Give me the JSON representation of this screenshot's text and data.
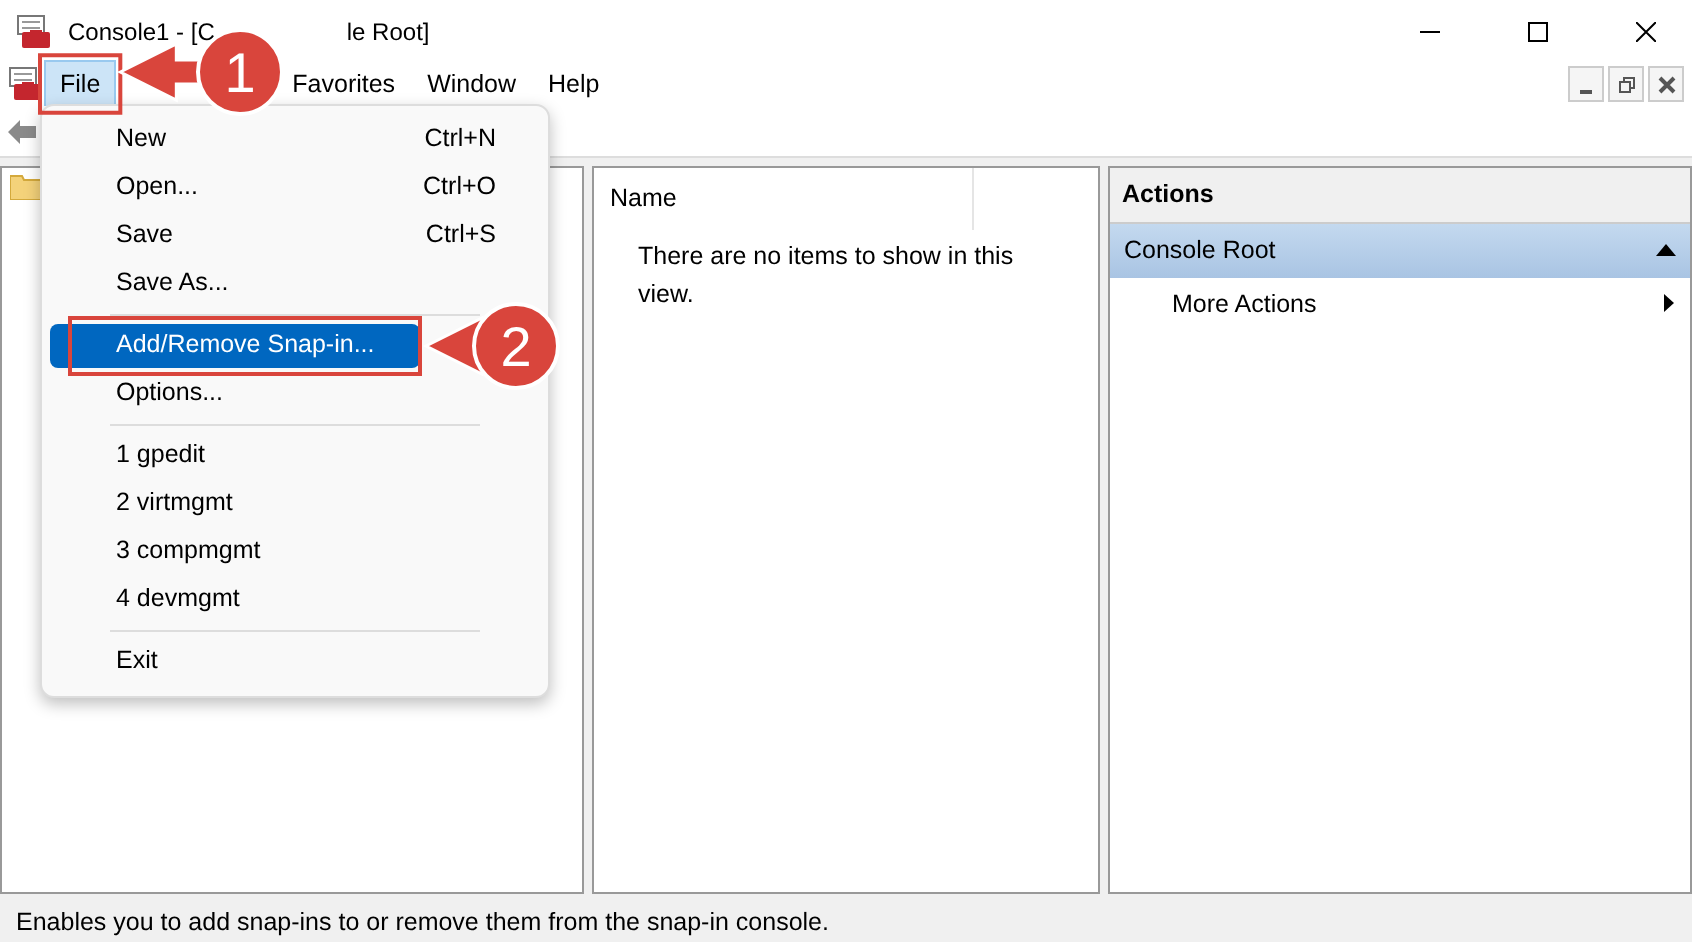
{
  "window": {
    "title_parts": [
      "Console1 - [C",
      "le Root]"
    ]
  },
  "menu_bar": [
    {
      "label": "File",
      "selected": true
    },
    {
      "label": "Favorites",
      "selected": false
    },
    {
      "label": "Window",
      "selected": false
    },
    {
      "label": "Help",
      "selected": false
    }
  ],
  "file_menu": [
    {
      "kind": "item",
      "label": "New",
      "shortcut": "Ctrl+N",
      "selected": false
    },
    {
      "kind": "item",
      "label": "Open...",
      "shortcut": "Ctrl+O",
      "selected": false
    },
    {
      "kind": "item",
      "label": "Save",
      "shortcut": "Ctrl+S",
      "selected": false
    },
    {
      "kind": "item",
      "label": "Save As...",
      "selected": false
    },
    {
      "kind": "separator"
    },
    {
      "kind": "item",
      "label": "Add/Remove Snap-in...",
      "selected": true
    },
    {
      "kind": "item",
      "label": "Options...",
      "selected": false
    },
    {
      "kind": "separator"
    },
    {
      "kind": "item",
      "label": "1 gpedit",
      "selected": false
    },
    {
      "kind": "item",
      "label": "2 virtmgmt",
      "selected": false
    },
    {
      "kind": "item",
      "label": "3 compmgmt",
      "selected": false
    },
    {
      "kind": "item",
      "label": "4 devmgmt",
      "selected": false
    },
    {
      "kind": "separator"
    },
    {
      "kind": "item",
      "label": "Exit",
      "selected": false
    }
  ],
  "list_view": {
    "columns": [
      "Name"
    ],
    "empty_message": "There are no items to show in this view."
  },
  "actions_pane": {
    "title": "Actions",
    "section": {
      "label": "Console Root",
      "expanded": true
    },
    "items": [
      {
        "label": "More Actions"
      }
    ]
  },
  "annotations": [
    {
      "label": "1"
    },
    {
      "label": "2"
    }
  ],
  "status_bar": "Enables you to add snap-ins to or remove them from the snap-in console."
}
